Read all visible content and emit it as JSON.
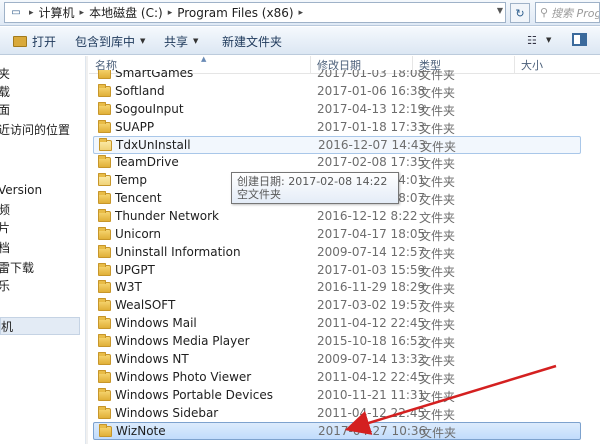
{
  "address": {
    "crumbs": [
      "计算机",
      "本地磁盘 (C:)",
      "Program Files (x86)"
    ],
    "search_placeholder": "搜索 Prog..."
  },
  "toolbar": {
    "open_label": "打开",
    "include_label": "包含到库中",
    "share_label": "共享",
    "new_folder_label": "新建文件夹"
  },
  "nav": {
    "items": [
      "夹",
      "载",
      "面",
      "近访问的位置",
      "Version",
      "频",
      "片",
      "档",
      "雷下载",
      "乐",
      "机"
    ]
  },
  "columns": {
    "name": "名称",
    "date": "修改日期",
    "type": "类型",
    "size": "大小"
  },
  "files": [
    {
      "name": "SmartGames",
      "date": "2017-01-03 18:08",
      "type": "文件夹"
    },
    {
      "name": "Softland",
      "date": "2017-01-06 16:38",
      "type": "文件夹"
    },
    {
      "name": "SogouInput",
      "date": "2017-04-13 12:19",
      "type": "文件夹"
    },
    {
      "name": "SUAPP",
      "date": "2017-01-18 17:33",
      "type": "文件夹"
    },
    {
      "name": "TdxUnInstall",
      "date": "2016-12-07 14:43",
      "type": "文件夹"
    },
    {
      "name": "TeamDrive",
      "date": "2017-02-08 17:35",
      "type": "文件夹"
    },
    {
      "name": "Temp",
      "date": "2017-02-08 14:01",
      "type": "文件夹"
    },
    {
      "name": "Tencent",
      "date": "2017-04-18 18:07",
      "type": "文件夹"
    },
    {
      "name": "Thunder Network",
      "date": "2016-12-12 8:22",
      "type": "文件夹"
    },
    {
      "name": "Unicorn",
      "date": "2017-04-17 18:05",
      "type": "文件夹"
    },
    {
      "name": "Uninstall Information",
      "date": "2009-07-14 12:57",
      "type": "文件夹"
    },
    {
      "name": "UPGPT",
      "date": "2017-01-03 15:59",
      "type": "文件夹"
    },
    {
      "name": "W3T",
      "date": "2016-11-29 18:29",
      "type": "文件夹"
    },
    {
      "name": "WealSOFT",
      "date": "2017-03-02 19:57",
      "type": "文件夹"
    },
    {
      "name": "Windows Mail",
      "date": "2011-04-12 22:45",
      "type": "文件夹"
    },
    {
      "name": "Windows Media Player",
      "date": "2015-10-18 16:52",
      "type": "文件夹"
    },
    {
      "name": "Windows NT",
      "date": "2009-07-14 13:32",
      "type": "文件夹"
    },
    {
      "name": "Windows Photo Viewer",
      "date": "2011-04-12 22:45",
      "type": "文件夹"
    },
    {
      "name": "Windows Portable Devices",
      "date": "2010-11-21 11:31",
      "type": "文件夹"
    },
    {
      "name": "Windows Sidebar",
      "date": "2011-04-12 22:45",
      "type": "文件夹"
    },
    {
      "name": "WizNote",
      "date": "2017-04-27 10:36",
      "type": "文件夹"
    }
  ],
  "tooltip": {
    "line1": "创建日期: 2017-02-08 14:22",
    "line2": "空文件夹"
  },
  "colors": {
    "selection": "#c1dcfc",
    "hover_border": "#a9c7e9",
    "arrow": "#d42020"
  },
  "icons": {
    "folder": "folder-icon",
    "refresh": "refresh-icon",
    "views": "views-icon",
    "preview": "preview-pane-icon"
  }
}
